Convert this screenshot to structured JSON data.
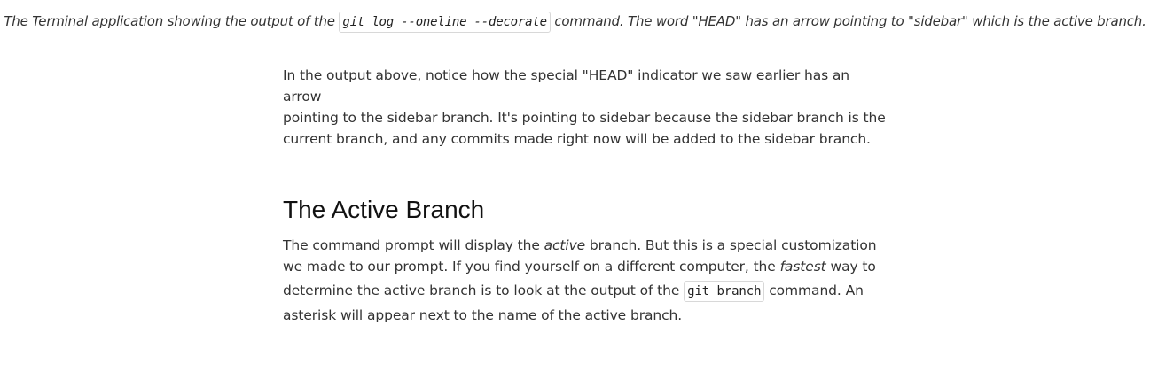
{
  "caption": {
    "before": "The Terminal application showing the output of the ",
    "code": "git log --oneline --decorate",
    "after": " command. The word \"HEAD\" has an arrow pointing to \"sidebar\" which is the active branch."
  },
  "paragraph1": {
    "line1": "In the output above, notice how the special \"HEAD\" indicator we saw earlier has an arrow",
    "line2": "pointing to the sidebar branch. It's pointing to sidebar because the sidebar branch is the",
    "line3": "current branch, and any commits made right now will be added to the sidebar branch."
  },
  "heading": "The Active Branch",
  "paragraph2": {
    "p1": "The command prompt will display the ",
    "em1": "active",
    "p2": " branch. But this is a special customization",
    "p3": "we made to our prompt. If you find yourself on a different computer, the ",
    "em2": "fastest",
    "p4": " way to",
    "p5": "determine the active branch is to look at the output of the ",
    "code": "git branch",
    "p6": " command. An",
    "p7": "asterisk will appear next to the name of the active branch."
  }
}
